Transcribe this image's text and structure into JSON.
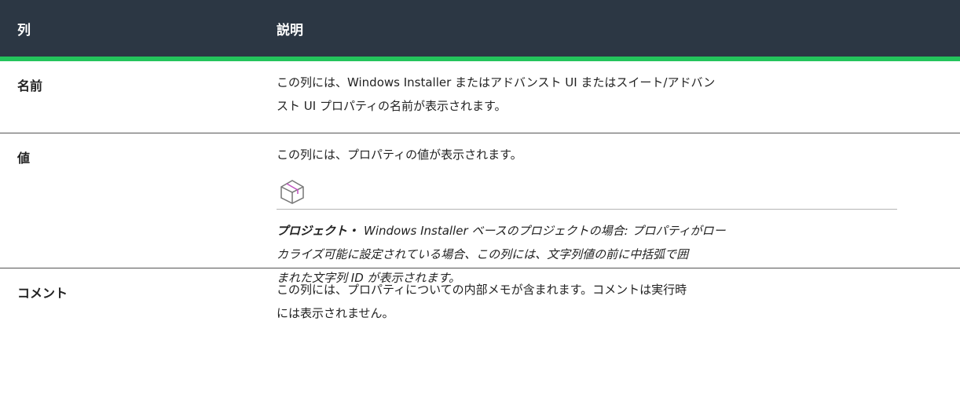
{
  "table": {
    "headers": {
      "column": "列",
      "description": "説明"
    },
    "rows": [
      {
        "name": "名前",
        "desc_line1": "この列には、Windows Installer またはアドバンスト UI またはスイート/アドバン",
        "desc_line2": "スト UI プロパティの名前が表示されます。"
      },
      {
        "name": "値",
        "desc_line1": "この列には、プロパティの値が表示されます。",
        "note_icon": "package-box-icon",
        "note_label": "プロジェクト・",
        "note_line1": "Windows Installer ベースのプロジェクトの場合: プロパティがロー",
        "note_line2": "カライズ可能に設定されている場合、この列には、文字列値の前に中括弧で囲",
        "note_line3": "まれた文字列 ID が表示されます。"
      },
      {
        "name": "コメント",
        "desc_line1": "この列には、プロパティについての内部メモが含まれます。コメントは実行時",
        "desc_line2": "には表示されません。"
      }
    ]
  },
  "colors": {
    "header_bg": "#2c3744",
    "header_accent": "#24c45c",
    "icon_accent": "#c050c0"
  }
}
